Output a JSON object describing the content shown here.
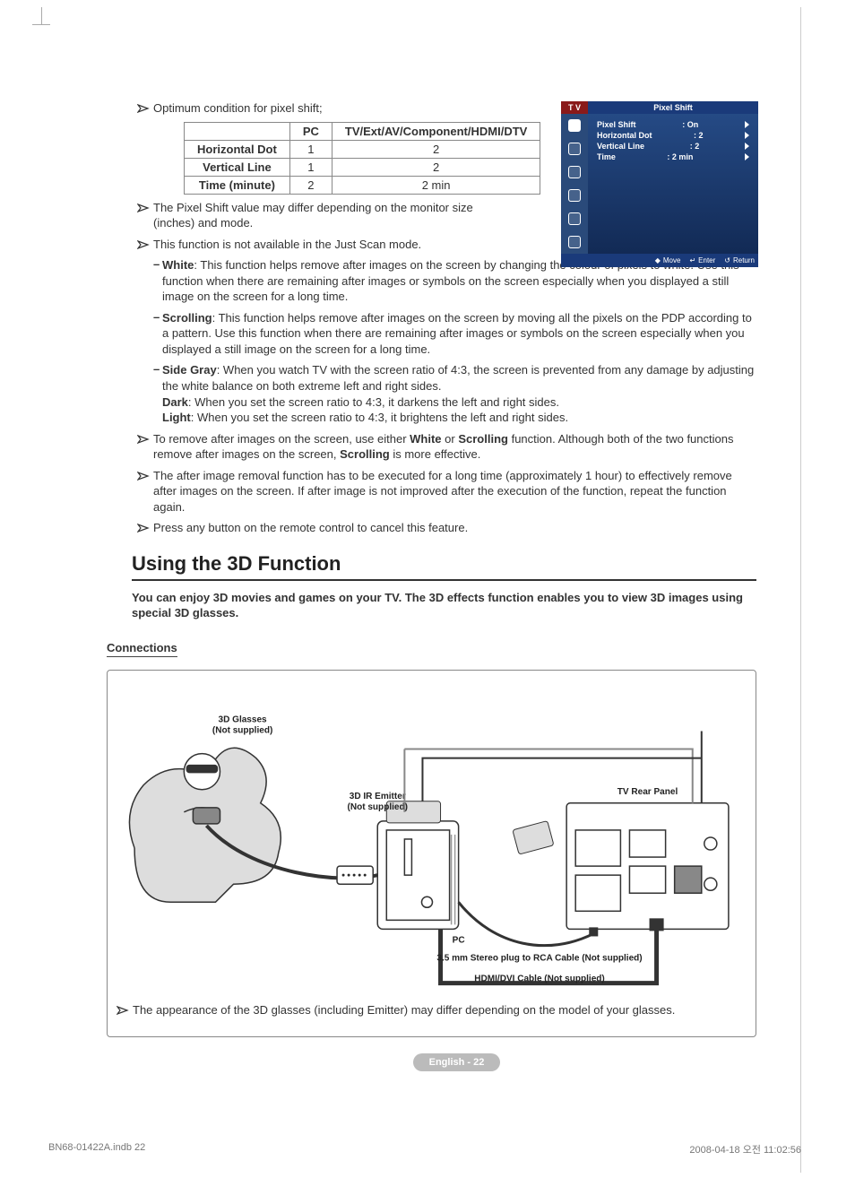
{
  "bullets": {
    "optimum": "Optimum condition for pixel shift;",
    "pixelShiftNote": "The Pixel Shift value may differ depending on the monitor size (inches) and mode.",
    "justScanNote": "This function is not available in the Just Scan mode.",
    "removeNote_a": "To remove after images on the screen, use either ",
    "removeNote_b": " or ",
    "removeNote_c": " function. Although both of the two functions remove after images on the screen, ",
    "removeNote_d": " is more effective.",
    "removeNote_bold1": "White",
    "removeNote_bold2": "Scrolling",
    "removeNote_bold3": "Scrolling",
    "longTimeNote": "The after image removal function has to be executed for a long time (approximately 1 hour) to effectively remove after images on the screen. If after image is not improved after the execution of the function, repeat the function again.",
    "pressAny": "Press any button on the remote control to cancel this feature.",
    "appearance": "The appearance of the 3D glasses (including Emitter) may differ depending on the model of your glasses."
  },
  "dashes": {
    "white_label": "White",
    "white_text": ": This function helps remove after images on the screen by changing the colour of pixels to white. Use this function when there are remaining after images or symbols on the screen especially when you displayed a still image on the screen for a long time.",
    "scrolling_label": "Scrolling",
    "scrolling_text": ": This function helps remove after images on the screen by moving all the pixels on the PDP according to a pattern. Use this function when there are remaining after images or symbols on the screen especially when you displayed a still image on the screen for a long time.",
    "sidegray_label": "Side Gray",
    "sidegray_text": ": When you watch TV with the screen ratio of 4:3, the screen is prevented from any damage by adjusting the white balance on both extreme left and right sides.",
    "dark_label": "Dark",
    "dark_text": ": When you set the screen ratio to 4:3, it darkens the left and right sides.",
    "light_label": "Light",
    "light_text": ": When you set the screen ratio to 4:3, it brightens the left and right sides."
  },
  "table": {
    "col1": "PC",
    "col2": "TV/Ext/AV/Component/HDMI/DTV",
    "rows": [
      {
        "h": "Horizontal Dot",
        "c1": "1",
        "c2": "2"
      },
      {
        "h": "Vertical Line",
        "c1": "1",
        "c2": "2"
      },
      {
        "h": "Time (minute)",
        "c1": "2",
        "c2": "2 min"
      }
    ]
  },
  "osd": {
    "tv": "T V",
    "title": "Pixel Shift",
    "rows": [
      {
        "label": "Pixel Shift",
        "value": ": On"
      },
      {
        "label": "Horizontal Dot",
        "value": ": 2"
      },
      {
        "label": "Vertical Line",
        "value": ": 2"
      },
      {
        "label": "Time",
        "value": ": 2 min"
      }
    ],
    "foot": {
      "move": "Move",
      "enter": "Enter",
      "return": "Return"
    }
  },
  "section": {
    "title": "Using the 3D Function",
    "intro": "You can enjoy 3D movies and games on your TV. The 3D effects function enables you to view 3D images using special 3D glasses.",
    "sub": "Connections"
  },
  "diagram": {
    "glasses": "3D Glasses",
    "glasses2": "(Not supplied)",
    "emitter": "3D IR Emitter",
    "emitter2": "(Not supplied)",
    "rear": "TV Rear Panel",
    "pc": "PC",
    "stereo": "3.5 mm Stereo plug to RCA Cable (Not supplied)",
    "hdmi": "HDMI/DVI Cable (Not supplied)"
  },
  "pagefoot": "English - 22",
  "printfoot": {
    "left": "BN68-01422A.indb   22",
    "right": "2008-04-18   오전 11:02:56"
  }
}
